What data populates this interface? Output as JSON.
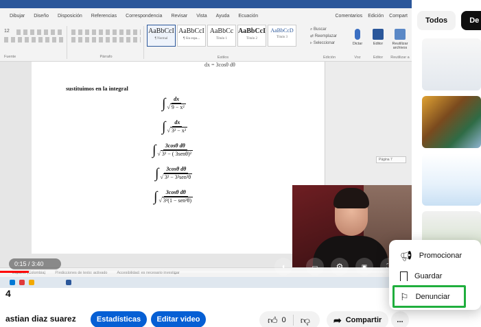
{
  "word": {
    "menu": [
      "Dibujar",
      "Diseño",
      "Disposición",
      "Referencias",
      "Correspondencia",
      "Revisar",
      "Vista",
      "Ayuda",
      "Ecuación"
    ],
    "menu_right": [
      "Comentarios",
      "Edición",
      "Compart"
    ],
    "ribbon": {
      "font_label": "Fuente",
      "paragraph_label": "Párrafo",
      "styles_label": "Estilos",
      "edit_label": "Edición",
      "voice_label": "Voz",
      "editor_label": "Editor",
      "reuse_label": "Reutilizar a",
      "font_size": "12",
      "styles": [
        {
          "name": "AaBbCcI",
          "sub": "¶ Normal"
        },
        {
          "name": "AaBbCcI",
          "sub": "¶ Sin espa..."
        },
        {
          "name": "AaBbCc",
          "sub": "Título 1"
        },
        {
          "name": "AaBbCcI",
          "sub": "Título 2"
        },
        {
          "name": "AaBbCcD",
          "sub": "Título 3"
        }
      ],
      "find": "Buscar",
      "replace": "Reemplazar",
      "select": "Seleccionar",
      "dictate": "Dictar",
      "editor": "Editor",
      "reuse": "Reutilizar archivos"
    },
    "doc": {
      "cut_line": "dx = 3cosθ dθ",
      "heading": "sustituimos en la integral",
      "integrals": [
        {
          "num": "dx",
          "den": "9 − x²"
        },
        {
          "num": "dx",
          "den": "3² − x²"
        },
        {
          "num": "3cosθ dθ",
          "den": "3² − ( 3senθ)²"
        },
        {
          "num": "3cosθ dθ",
          "den": "3² − 3²sen²θ"
        },
        {
          "num": "3cosθ dθ",
          "den": "3²(1 − sen²θ)"
        }
      ]
    },
    "page_indicator": "Página 7",
    "status": [
      "Español (Colombia)",
      "Predicciones de texto: activado",
      "Accesibilidad: es necesario investigar"
    ]
  },
  "player": {
    "time": "0:15 / 3:40",
    "progress": 0.07
  },
  "sidebar": {
    "chips": [
      "Todos",
      "De ju"
    ]
  },
  "video": {
    "title": "4",
    "channel": "astian diaz suarez",
    "stats_button": "Estadísticas",
    "edit_button": "Editar video",
    "like_count": "0",
    "share_label": "Compartir",
    "more_label": "..."
  },
  "menu": {
    "promote": "Promocionar",
    "save": "Guardar",
    "report": "Denunciar"
  },
  "colors": {
    "accent_blue": "#065fd4",
    "highlight_green": "#1fae3d",
    "word_blue": "#2b579a",
    "progress_red": "#ff0000"
  }
}
